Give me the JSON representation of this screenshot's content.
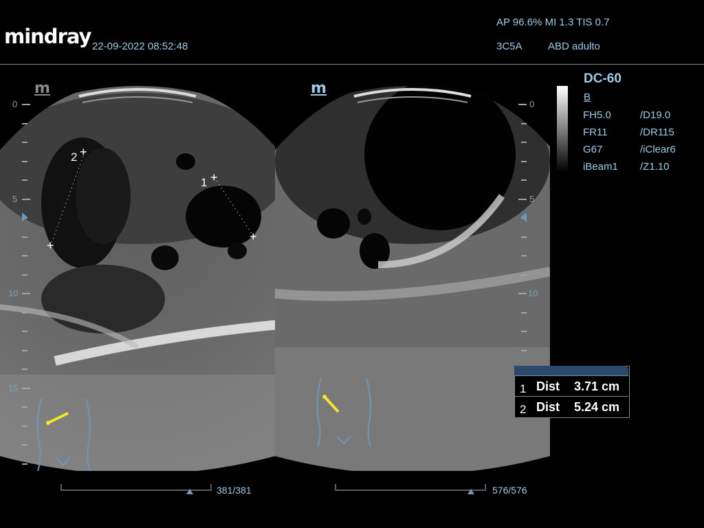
{
  "header": {
    "logo": "mindray",
    "datetime": "22-09-2022 08:52:48",
    "acoustic": "AP 96.6%  MI 1.3 TIS 0.7",
    "probe": "3C5A",
    "preset": "ABD adulto"
  },
  "params": {
    "system": "DC-60",
    "mode": "B",
    "rows": [
      {
        "left": "FH5.0",
        "right": "/D19.0"
      },
      {
        "left": "FR11",
        "right": "/DR115"
      },
      {
        "left": "G67",
        "right": "/iClear6"
      },
      {
        "left": "iBeam1",
        "right": "/Z1.10"
      }
    ]
  },
  "depth_scale": {
    "labels": [
      "0",
      "5",
      "10",
      "15"
    ]
  },
  "left_image": {
    "icon_letter": "m",
    "frame_counter": "381/381",
    "calipers": [
      {
        "label": "1"
      },
      {
        "label": "2"
      }
    ]
  },
  "right_image": {
    "icon_letter": "m",
    "frame_counter": "576/576"
  },
  "measurements": [
    {
      "index": "1",
      "type": "Dist",
      "value": "3.71 cm"
    },
    {
      "index": "2",
      "type": "Dist",
      "value": "5.24 cm"
    }
  ],
  "colors": {
    "text_blue": "#9ecbe6",
    "caliper_white": "#ffffff",
    "probe_marker_yellow": "#f5e52a",
    "body_mark_blue": "#6f97b5",
    "measurement_header": "#2a4a6e"
  }
}
